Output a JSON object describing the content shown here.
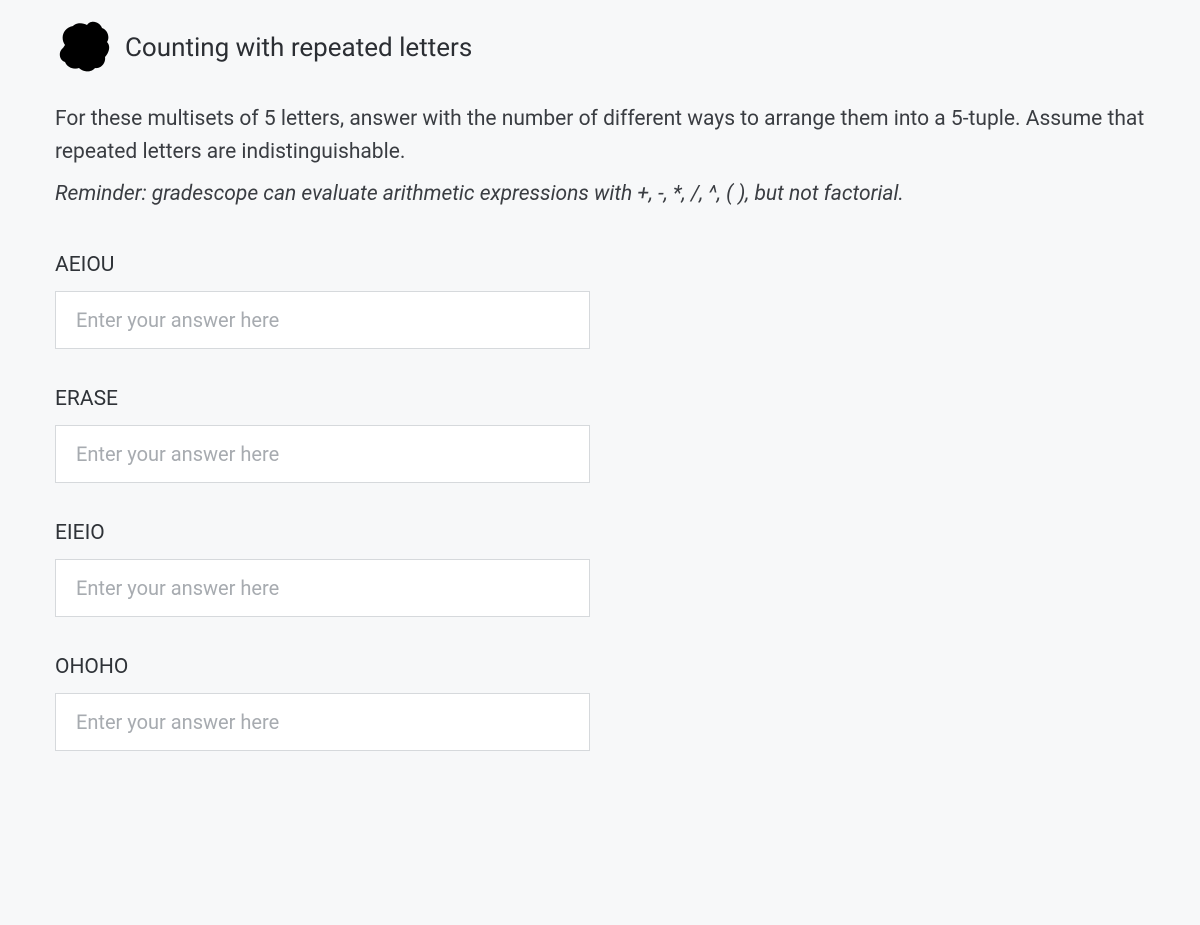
{
  "title": "Counting with repeated letters",
  "instructions": "For these multisets of 5 letters, answer with the number of different ways to arrange them into a 5-tuple. Assume that repeated letters are indistinguishable.",
  "reminder": "Reminder: gradescope can evaluate arithmetic expressions with +, -, *, /, ^, ( ), but not factorial.",
  "placeholder": "Enter your answer here",
  "questions": [
    {
      "label": "AEIOU"
    },
    {
      "label": "ERASE"
    },
    {
      "label": "EIEIO"
    },
    {
      "label": "OHOHO"
    }
  ]
}
